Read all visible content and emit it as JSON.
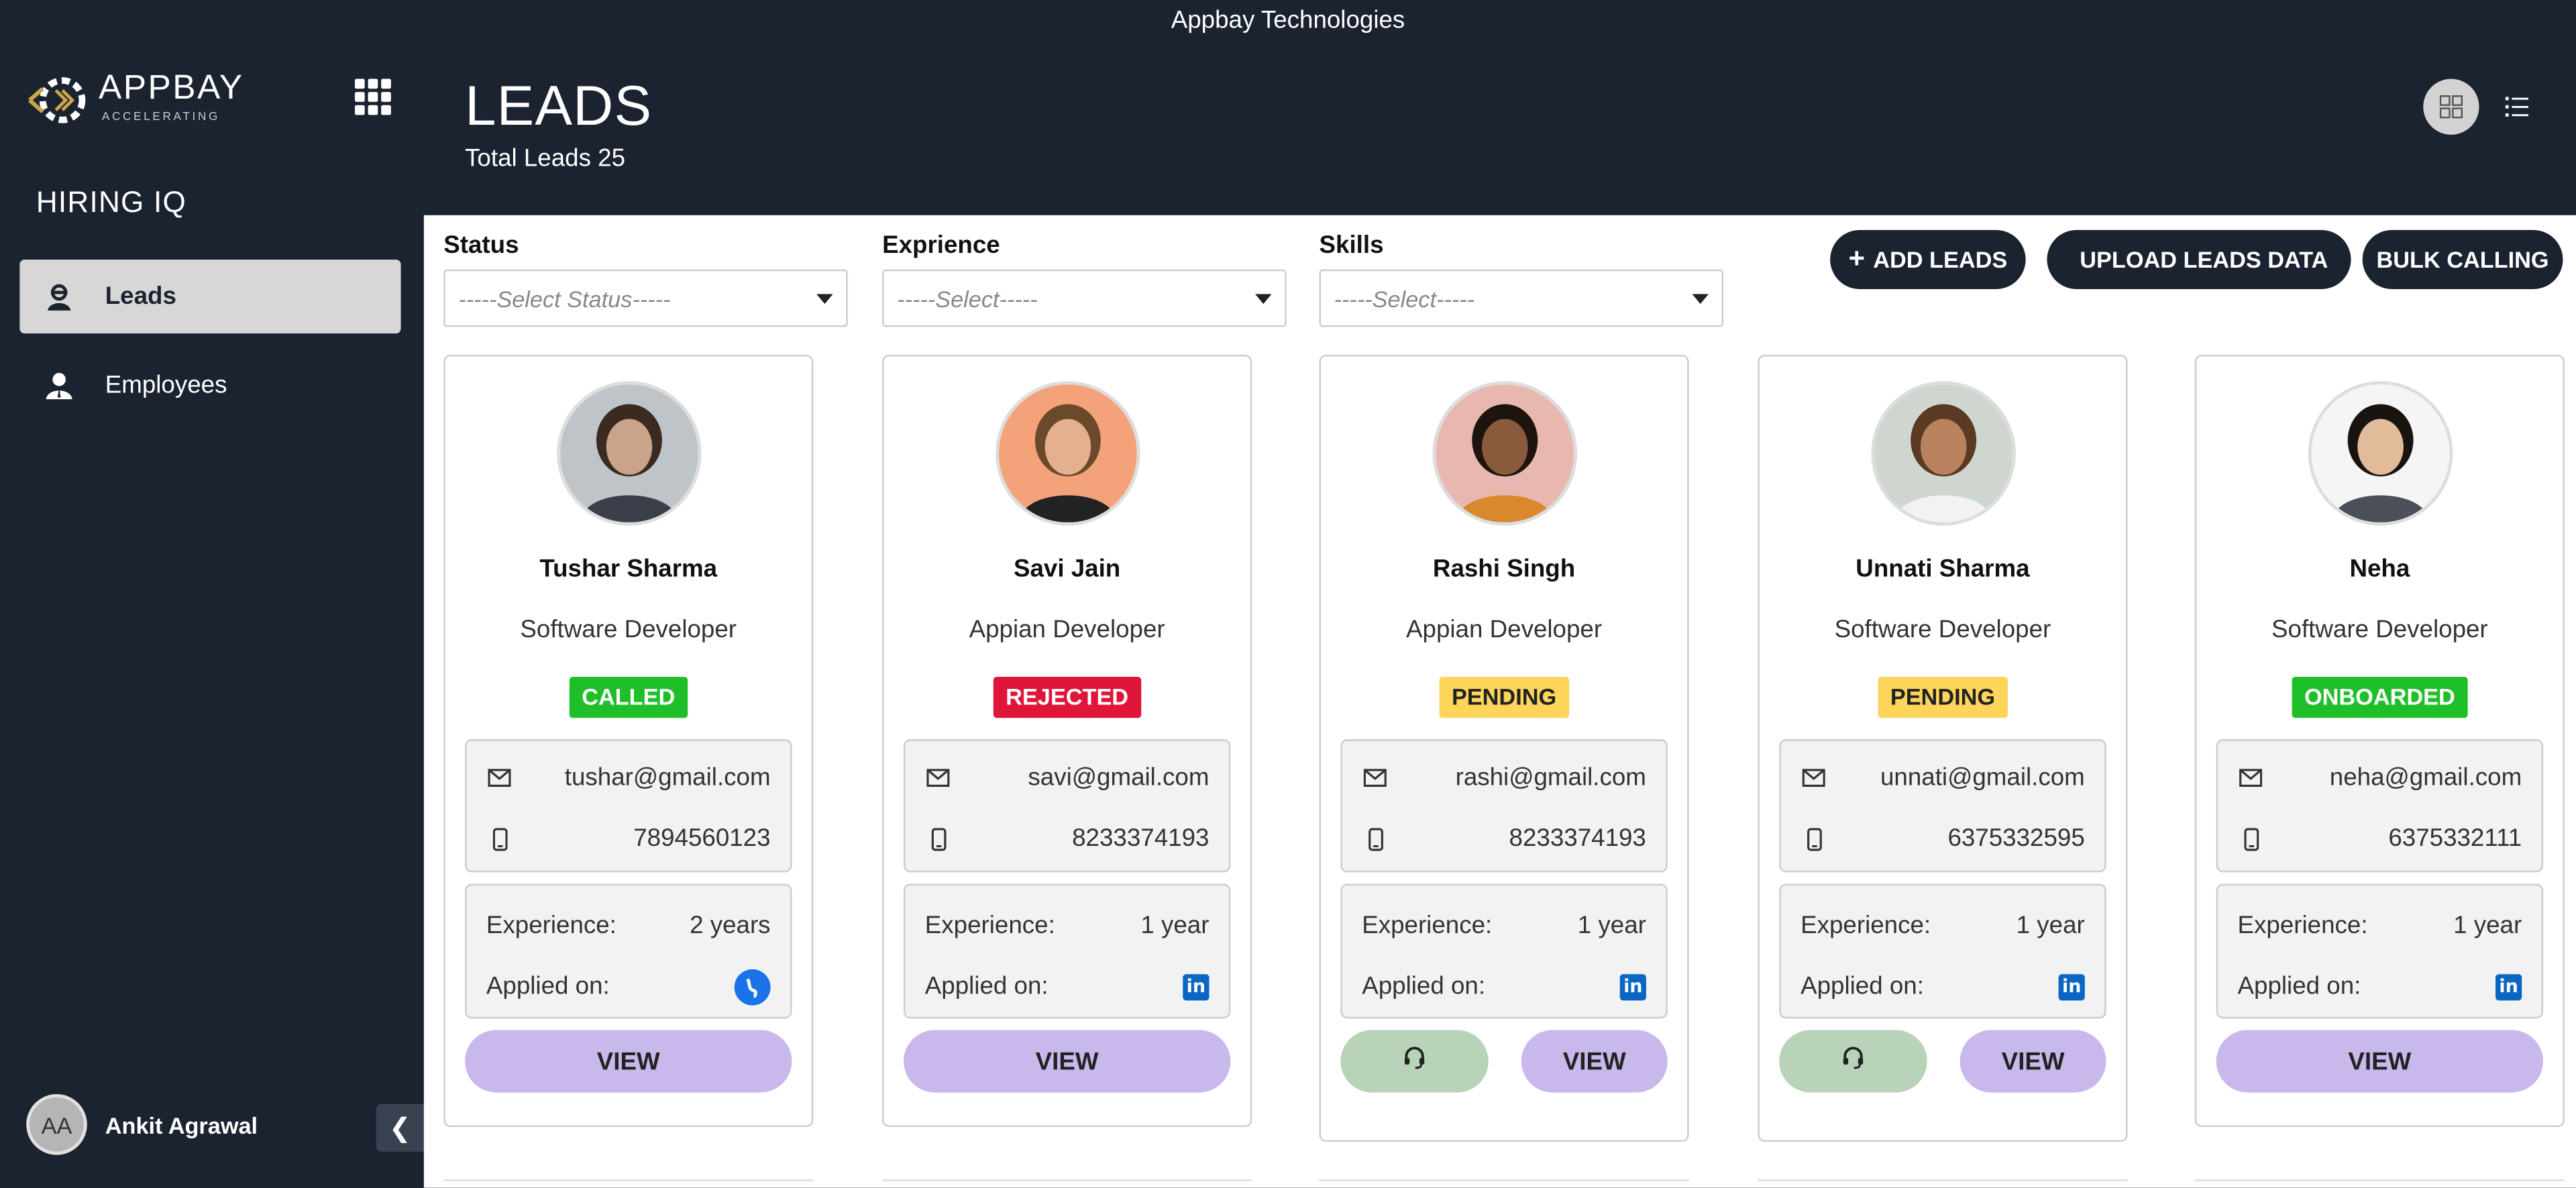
{
  "window": {
    "title": "Appbay Technologies"
  },
  "sidebar": {
    "logo_text": "APPBAY",
    "logo_tagline": "ACCELERATING",
    "app_name": "HIRING IQ",
    "items": [
      {
        "label": "Leads",
        "icon": "lead-person-icon",
        "active": true
      },
      {
        "label": "Employees",
        "icon": "employee-person-icon",
        "active": false
      }
    ],
    "user": {
      "initials": "AA",
      "name": "Ankit Agrawal"
    }
  },
  "header": {
    "title": "LEADS",
    "subtitle": "Total Leads 25"
  },
  "filters": {
    "status": {
      "label": "Status",
      "placeholder": "-----Select Status-----"
    },
    "experience": {
      "label": "Exprience",
      "placeholder": "-----Select-----"
    },
    "skills": {
      "label": "Skills",
      "placeholder": "-----Select-----"
    }
  },
  "actions": {
    "add_leads": "ADD LEADS",
    "upload_leads": "UPLOAD LEADS DATA",
    "bulk_calling": "BULK CALLING"
  },
  "labels": {
    "experience": "Experience:",
    "applied_on": "Applied on:",
    "view": "VIEW"
  },
  "colors": {
    "called": "#1fbf2a",
    "rejected": "#e0153a",
    "pending": "#fcd55a",
    "onboarded": "#1fbf2a",
    "view_button": "#c9b8ec",
    "call_button": "#b8d3b8",
    "dark": "#1b2230"
  },
  "leads": [
    {
      "name": "Tushar Sharma",
      "role": "Software Developer",
      "status": "CALLED",
      "email": "tushar@gmail.com",
      "phone": "7894560123",
      "experience": "2 years",
      "applied_via": "website-globe-icon",
      "has_call_button": false
    },
    {
      "name": "Savi Jain",
      "role": "Appian Developer",
      "status": "REJECTED",
      "email": "savi@gmail.com",
      "phone": "8233374193",
      "experience": "1 year",
      "applied_via": "linkedin-icon",
      "has_call_button": false
    },
    {
      "name": "Rashi Singh",
      "role": "Appian Developer",
      "status": "PENDING",
      "email": "rashi@gmail.com",
      "phone": "8233374193",
      "experience": "1 year",
      "applied_via": "linkedin-icon",
      "has_call_button": true
    },
    {
      "name": "Unnati Sharma",
      "role": "Software Developer",
      "status": "PENDING",
      "email": "unnati@gmail.com",
      "phone": "6375332595",
      "experience": "1 year",
      "applied_via": "linkedin-icon",
      "has_call_button": true
    },
    {
      "name": "Neha",
      "role": "Software Developer",
      "status": "ONBOARDED",
      "email": "neha@gmail.com",
      "phone": "6375332111",
      "experience": "1 year",
      "applied_via": "linkedin-icon",
      "has_call_button": false
    }
  ]
}
